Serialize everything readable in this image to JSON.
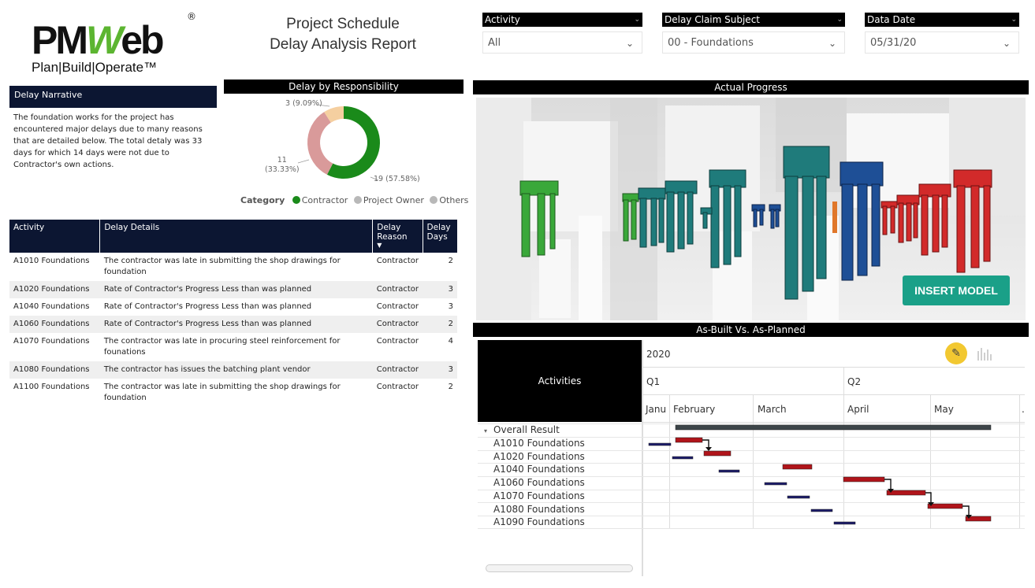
{
  "logo": {
    "brand_pm": "PM",
    "brand_w": "W",
    "brand_eb": "eb",
    "registered": "®",
    "tagline": "Plan|Build|Operate™"
  },
  "report": {
    "title_line1": "Project Schedule",
    "title_line2": "Delay Analysis Report"
  },
  "filters": [
    {
      "label": "Activity",
      "value": "All"
    },
    {
      "label": "Delay Claim Subject",
      "value": "00 - Foundations"
    },
    {
      "label": "Data Date",
      "value": "05/31/20"
    }
  ],
  "narrative": {
    "header": "Delay Narrative",
    "text": "The foundation works for the project has encountered major delays due to many reasons that are detailed below. The total detaly was 33 days for which 14 days were not due to Contractor's own actions."
  },
  "donut": {
    "title": "Delay by Responsibility",
    "segments": [
      {
        "name": "Contractor",
        "value": 19,
        "label": "19 (57.58%)",
        "color": "#1a8a1a"
      },
      {
        "name": "Project Owner",
        "value": 11,
        "label": "11\n(33.33%)",
        "color": "#d99a9a"
      },
      {
        "name": "Others",
        "value": 3,
        "label": "3 (9.09%)",
        "color": "#f5cfa0"
      }
    ],
    "legend_title": "Category",
    "legend": [
      {
        "name": "Contractor",
        "color": "#1a8a1a"
      },
      {
        "name": "Project Owner",
        "color": "#b8b8b8"
      },
      {
        "name": "Others",
        "color": "#b8b8b8"
      }
    ]
  },
  "delay_table": {
    "headers": [
      "Activity",
      "Delay Details",
      "Delay Reason",
      "Delay Days"
    ],
    "rows": [
      {
        "activity": "A1010 Foundations",
        "details": "The contractor was late in submitting the shop drawings for foundation",
        "reason": "Contractor",
        "days": "2"
      },
      {
        "activity": "A1020 Foundations",
        "details": "Rate of Contractor's Progress Less than was planned",
        "reason": "Contractor",
        "days": "3"
      },
      {
        "activity": "A1040 Foundations",
        "details": "Rate of Contractor's Progress Less than was planned",
        "reason": "Contractor",
        "days": "3"
      },
      {
        "activity": "A1060 Foundations",
        "details": "Rate of Contractor's Progress Less than was planned",
        "reason": "Contractor",
        "days": "2"
      },
      {
        "activity": "A1070 Foundations",
        "details": "The contractor was late in procuring steel reinforcement for founations",
        "reason": "Contractor",
        "days": "4"
      },
      {
        "activity": "A1080 Foundations",
        "details": "The contractor has issues the batching plant vendor",
        "reason": "Contractor",
        "days": "3"
      },
      {
        "activity": "A1100 Foundations",
        "details": "The contractor was late in submitting the shop drawings for foundation",
        "reason": "Contractor",
        "days": "2"
      }
    ]
  },
  "progress": {
    "title": "Actual Progress",
    "insert_label": "INSERT MODEL"
  },
  "gantt": {
    "title": "As-Built Vs. As-Planned",
    "left_header": "Activities",
    "year": "2020",
    "quarters": [
      "Q1",
      "Q2"
    ],
    "months": [
      "Janu",
      "February",
      "March",
      "April",
      "May",
      "."
    ],
    "summary_row": "Overall Result",
    "rows": [
      "A1010 Foundations",
      "A1020 Foundations",
      "A1040 Foundations",
      "A1060 Foundations",
      "A1070 Foundations",
      "A1080 Foundations",
      "A1090 Foundations"
    ],
    "colors": {
      "actual": "#b0141a",
      "planned": "#1c1c6a",
      "summary": "#3d4549"
    }
  }
}
